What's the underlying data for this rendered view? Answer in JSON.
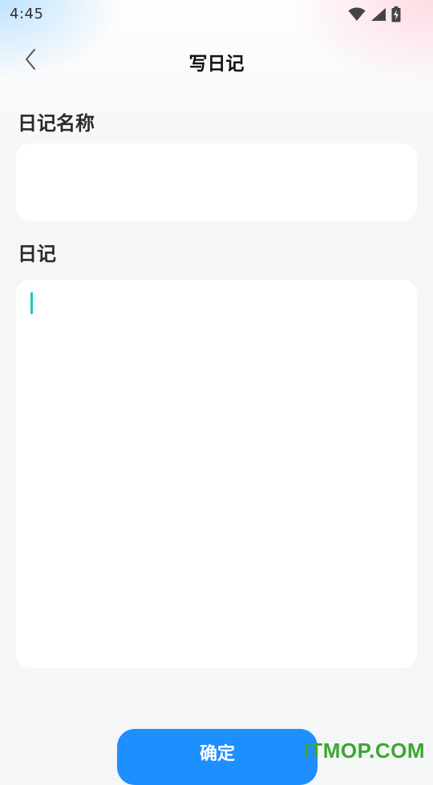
{
  "status_bar": {
    "time": "4:45",
    "icons": [
      "wifi-icon",
      "cell-signal-icon",
      "battery-charging-icon"
    ]
  },
  "header": {
    "back_icon": "chevron-left-icon",
    "title": "写日记"
  },
  "form": {
    "name_label": "日记名称",
    "name_value": "",
    "diary_label": "日记",
    "diary_value": ""
  },
  "footer": {
    "confirm_label": "确定"
  },
  "watermark": "ITMOP.COM",
  "colors": {
    "accent": "#1e8fff",
    "caret": "#1fc8c0",
    "background": "#f5f6f8",
    "watermark": "#3aa82e"
  }
}
